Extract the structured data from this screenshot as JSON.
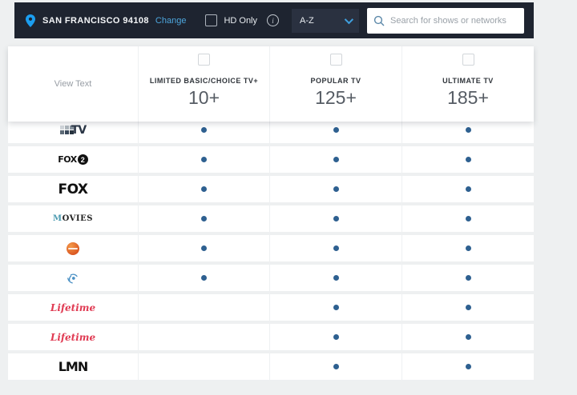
{
  "colors": {
    "topbar_bg": "#1e2430",
    "accent_blue": "#3f9fdd",
    "dot_blue": "#2e6090",
    "lifetime_red": "#e03a52",
    "globe_orange": "#d95420"
  },
  "topbar": {
    "location": "SAN FRANCISCO 94108",
    "change_label": "Change",
    "hd_only_label": "HD Only",
    "info_glyph": "i",
    "sort_value": "A-Z",
    "search_placeholder": "Search for shows or networks",
    "icons": {
      "pin": "location-pin-icon",
      "search": "search-icon",
      "chevron": "chevron-down-icon"
    }
  },
  "table_header": {
    "view_text_label": "View Text",
    "packages": [
      {
        "name": "LIMITED BASIC/CHOICE TV+",
        "count": "10+",
        "checked": false
      },
      {
        "name": "POPULAR TV",
        "count": "125+",
        "checked": false
      },
      {
        "name": "ULTIMATE TV",
        "count": "185+",
        "checked": false
      }
    ]
  },
  "channels": [
    {
      "logo_style": "mosaic",
      "logo_text": "TV",
      "tiles": [
        "#d3d7db",
        "#aeb6bd",
        "#8b96a1",
        "#5d6a77",
        "#39485a",
        "#27333f"
      ],
      "availability": [
        true,
        true,
        true
      ]
    },
    {
      "logo_style": "fox2",
      "logo_text": "FOX",
      "logo_badge": "2",
      "availability": [
        true,
        true,
        true
      ]
    },
    {
      "logo_style": "fox",
      "logo_text": "FOX",
      "availability": [
        true,
        true,
        true
      ]
    },
    {
      "logo_style": "movies",
      "logo_text": "MOVIES",
      "availability": [
        true,
        true,
        true
      ]
    },
    {
      "logo_style": "orange-globe",
      "logo_text": "",
      "availability": [
        true,
        true,
        true
      ]
    },
    {
      "logo_style": "signal",
      "logo_text": "",
      "availability": [
        true,
        true,
        true
      ]
    },
    {
      "logo_style": "lifetime",
      "logo_text": "Lifetime",
      "availability": [
        false,
        true,
        true
      ]
    },
    {
      "logo_style": "lifetime",
      "logo_text": "Lifetime",
      "availability": [
        false,
        true,
        true
      ]
    },
    {
      "logo_style": "lmn",
      "logo_text": "LMN",
      "availability": [
        false,
        true,
        true
      ]
    }
  ]
}
